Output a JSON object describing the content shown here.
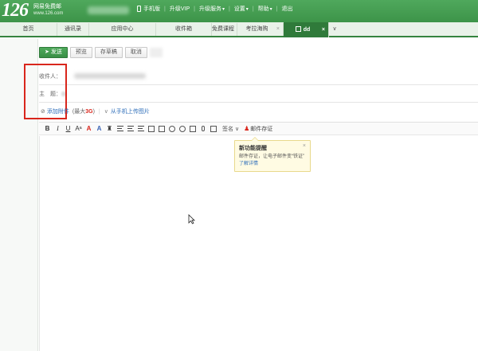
{
  "header": {
    "logo_number": "126",
    "logo_name": "网易免费邮",
    "logo_url": "www.126.com",
    "nav": [
      {
        "label": "手机版"
      },
      {
        "label": "升级VIP"
      },
      {
        "label": "升级服务"
      },
      {
        "label": "设置"
      },
      {
        "label": "帮助"
      },
      {
        "label": "退出"
      }
    ]
  },
  "tabs": [
    {
      "label": "首页"
    },
    {
      "label": "通讯录"
    },
    {
      "label": "应用中心"
    },
    {
      "label": "收件箱"
    },
    {
      "label": "免费课程"
    },
    {
      "label": "考拉海购"
    },
    {
      "label": "dd"
    }
  ],
  "toolbar": {
    "send": "发送",
    "preview": "预览",
    "save_draft": "存草稿",
    "cancel": "取消"
  },
  "form": {
    "to_label": "收件人：",
    "subject_label": "主　题：",
    "attach": "添加附件",
    "attach_limit_prefix": "(最大",
    "attach_limit_value": "3G",
    "attach_limit_suffix": ")",
    "mobile_upload": "从手机上传图片"
  },
  "editor": {
    "sign": "签名",
    "seal": "邮件存证"
  },
  "tooltip": {
    "title": "新功能提醒",
    "body": "邮件存证，让电子邮件变“铁证”",
    "link": "了解详情"
  },
  "colors": {
    "brand_green": "#3d9449",
    "active_tab": "#2f7a3a",
    "highlight_red": "#d9261c"
  }
}
